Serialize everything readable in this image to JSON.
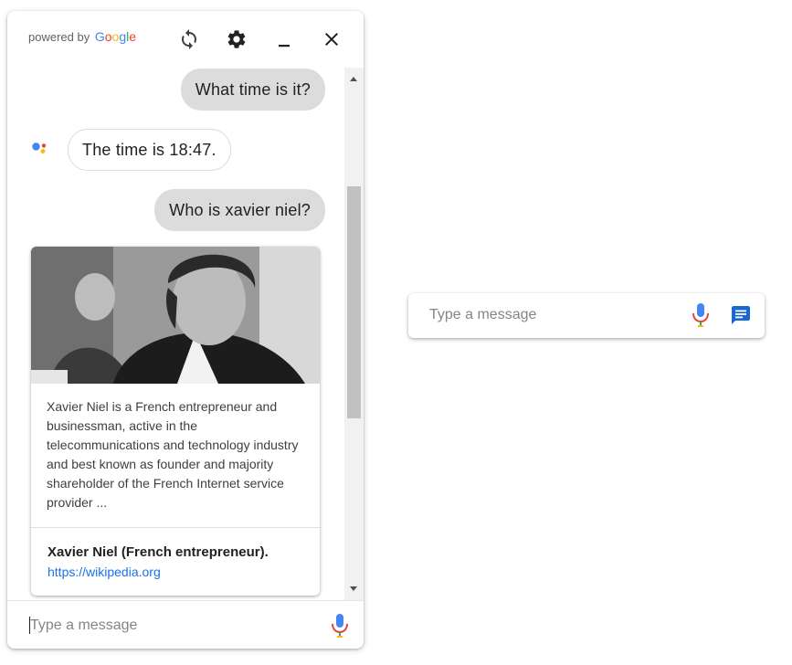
{
  "header": {
    "powered_by": "powered by",
    "brand": "Google",
    "icons": [
      "refresh-icon",
      "gear-icon",
      "minimize-icon",
      "close-icon"
    ]
  },
  "messages": [
    {
      "role": "user",
      "text": "What time is it?"
    },
    {
      "role": "assistant",
      "text": "The time is 18:47."
    },
    {
      "role": "user",
      "text": "Who is xavier niel?"
    }
  ],
  "card": {
    "description": "Xavier Niel is a French entrepreneur and businessman, active in the telecommunications and technology industry and best known as founder and majority shareholder of the French Internet service provider ...",
    "title": "Xavier Niel (French entrepreneur).",
    "link": "https://wikipedia.org"
  },
  "input": {
    "placeholder": "Type a message",
    "value": ""
  },
  "mini_input": {
    "placeholder": "Type a message"
  },
  "colors": {
    "google_blue": "#4285F4",
    "google_red": "#EA4335",
    "google_yellow": "#FBBC05",
    "google_green": "#34A853",
    "user_bubble": "#dcdcdc",
    "link": "#1a73e8",
    "chat_icon": "#1967d2"
  }
}
